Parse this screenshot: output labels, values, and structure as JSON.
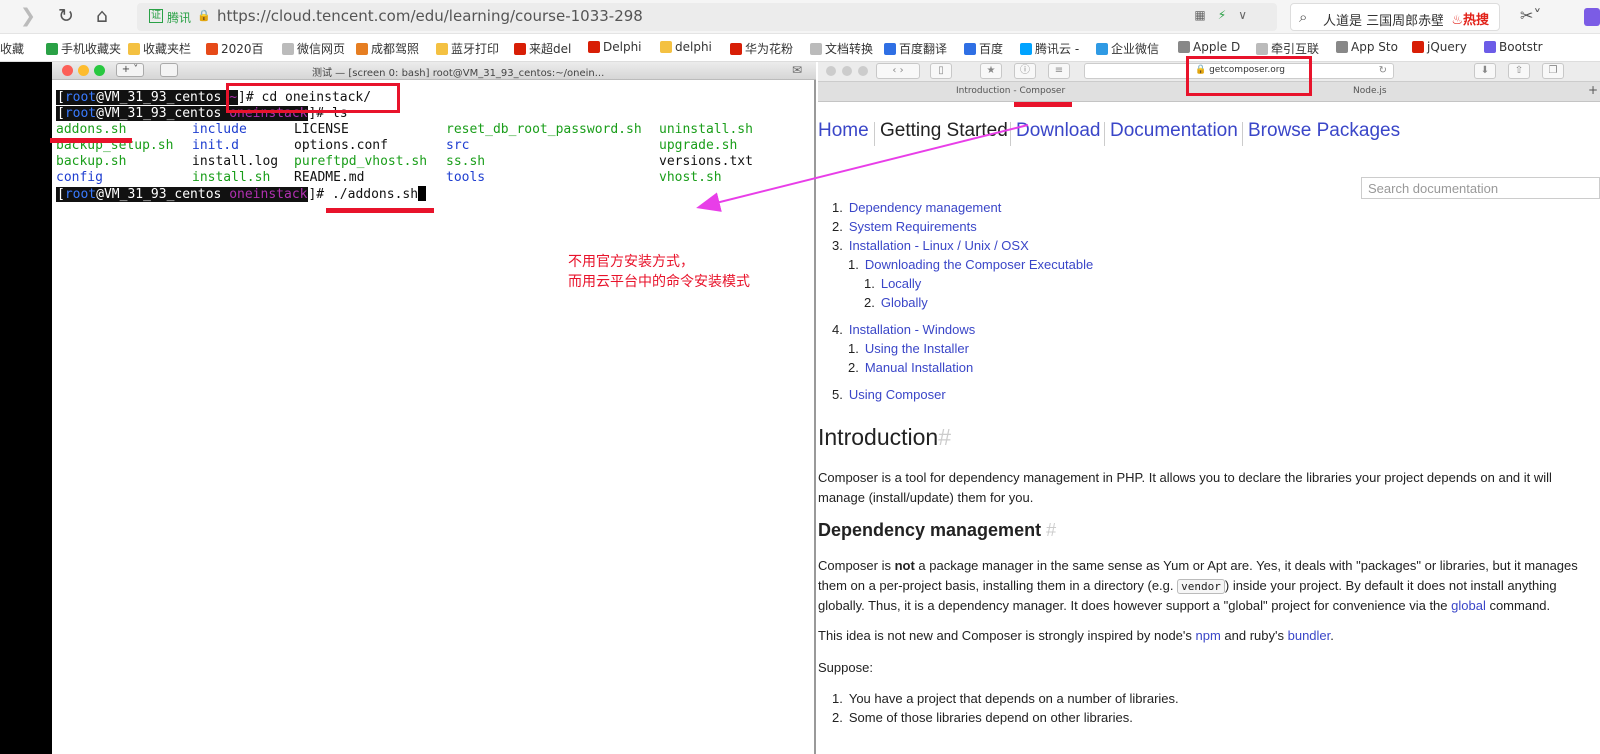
{
  "address_bar": {
    "cert_label": "证",
    "site_name": "腾讯",
    "url": "https://cloud.tencent.com/edu/learning/course-1033-298",
    "search_text": "人道是 三国周郎赤壁",
    "hot_label": "热搜"
  },
  "bookmarks": [
    {
      "label": "收藏",
      "color": "#ffffff"
    },
    {
      "label": "手机收藏夹",
      "color": "#2aa146"
    },
    {
      "label": "收藏夹栏",
      "color": "#f4c142"
    },
    {
      "label": "2020百",
      "color": "#e64a19"
    },
    {
      "label": "微信网页",
      "color": "#bbbbbb"
    },
    {
      "label": "成都驾照",
      "color": "#e67e22"
    },
    {
      "label": "蓝牙打印",
      "color": "#f4c142"
    },
    {
      "label": "来超del",
      "color": "#d81e06"
    },
    {
      "label": "Delphi",
      "color": "#d81e06"
    },
    {
      "label": "delphi",
      "color": "#f4c142"
    },
    {
      "label": "华为花粉",
      "color": "#d81e06"
    },
    {
      "label": "文档转换",
      "color": "#bbbbbb"
    },
    {
      "label": "百度翻译",
      "color": "#2f6fe4"
    },
    {
      "label": "百度",
      "color": "#2f6fe4"
    },
    {
      "label": "腾讯云 -",
      "color": "#00a3ff"
    },
    {
      "label": "企业微信",
      "color": "#2f9ae4"
    },
    {
      "label": "Apple D",
      "color": "#888888"
    },
    {
      "label": "牵引互联",
      "color": "#bbbbbb"
    },
    {
      "label": "App Sto",
      "color": "#888888"
    },
    {
      "label": "jQuery",
      "color": "#d81e06"
    },
    {
      "label": "Bootstr",
      "color": "#6c5ce7"
    }
  ],
  "terminal": {
    "title": "测试 — [screen 0: bash] root@VM_31_93_centos:~/onein...",
    "line1_user": "root",
    "line1_host": "@VM_31_93_centos ",
    "line1_dir": "~",
    "line1_cmd": "]# cd oneinstack/",
    "line2_user": "root",
    "line2_host": "@VM_31_93_centos ",
    "line2_dir": "oneinstack",
    "line2_cmd": "]# ls",
    "files": [
      {
        "name": "addons.sh",
        "color": "green",
        "col": 0,
        "row": 0
      },
      {
        "name": "include",
        "color": "blue",
        "col": 1,
        "row": 0
      },
      {
        "name": "LICENSE",
        "color": "black",
        "col": 2,
        "row": 0
      },
      {
        "name": "reset_db_root_password.sh",
        "color": "green",
        "col": 3,
        "row": 0
      },
      {
        "name": "uninstall.sh",
        "color": "green",
        "col": 4,
        "row": 0
      },
      {
        "name": "backup_setup.sh",
        "color": "green",
        "col": 0,
        "row": 1
      },
      {
        "name": "init.d",
        "color": "blue",
        "col": 1,
        "row": 1
      },
      {
        "name": "options.conf",
        "color": "black",
        "col": 2,
        "row": 1
      },
      {
        "name": "src",
        "color": "blue",
        "col": 3,
        "row": 1
      },
      {
        "name": "upgrade.sh",
        "color": "green",
        "col": 4,
        "row": 1
      },
      {
        "name": "backup.sh",
        "color": "green",
        "col": 0,
        "row": 2
      },
      {
        "name": "install.log",
        "color": "black",
        "col": 1,
        "row": 2
      },
      {
        "name": "pureftpd_vhost.sh",
        "color": "green",
        "col": 2,
        "row": 2
      },
      {
        "name": "ss.sh",
        "color": "green",
        "col": 3,
        "row": 2
      },
      {
        "name": "versions.txt",
        "color": "black",
        "col": 4,
        "row": 2
      },
      {
        "name": "config",
        "color": "blue",
        "col": 0,
        "row": 3
      },
      {
        "name": "install.sh",
        "color": "green",
        "col": 1,
        "row": 3
      },
      {
        "name": "README.md",
        "color": "black",
        "col": 2,
        "row": 3
      },
      {
        "name": "tools",
        "color": "blue",
        "col": 3,
        "row": 3
      },
      {
        "name": "vhost.sh",
        "color": "green",
        "col": 4,
        "row": 3
      }
    ],
    "line3_user": "root",
    "line3_host": "@VM_31_93_centos ",
    "line3_dir": "oneinstack",
    "line3_cmd": "]# ./addons.sh",
    "note_line1": "不用官方安装方式，",
    "note_line2": "而用云平台中的命令安装模式"
  },
  "browser": {
    "address": "getcomposer.org",
    "tab_active": "Introduction - Composer",
    "tab_other": "Node.js",
    "nav": [
      "Home",
      "Getting Started",
      "Download",
      "Documentation",
      "Browse Packages"
    ],
    "search_placeholder": "Search documentation",
    "toc": [
      {
        "num": "1.",
        "label": "Dependency management"
      },
      {
        "num": "2.",
        "label": "System Requirements"
      },
      {
        "num": "3.",
        "label": "Installation - Linux / Unix / OSX"
      },
      {
        "num": "1.",
        "label": "Downloading the Composer Executable"
      },
      {
        "num": "1.",
        "label": "Locally"
      },
      {
        "num": "2.",
        "label": "Globally"
      },
      {
        "num": "4.",
        "label": "Installation - Windows"
      },
      {
        "num": "1.",
        "label": "Using the Installer"
      },
      {
        "num": "2.",
        "label": "Manual Installation"
      },
      {
        "num": "5.",
        "label": "Using Composer"
      }
    ],
    "intro_heading": "Introduction",
    "intro_text": "Composer is a tool for dependency management in PHP. It allows you to declare the libraries your project depends on and it will manage (install/update) them for you.",
    "dep_heading": "Dependency management",
    "dep_p1_a": "Composer is ",
    "dep_p1_bold": "not",
    "dep_p1_b": " a package manager in the same sense as Yum or Apt are. Yes, it deals with \"packages\" or libraries, but it manages them on a per-project basis, installing them in a directory (e.g. ",
    "dep_p1_code": "vendor",
    "dep_p1_c": ") inside your project. By default it does not install anything globally. Thus, it is a dependency manager. It does however support a \"global\" project for convenience via the ",
    "dep_p1_link": "global",
    "dep_p1_d": " command.",
    "dep_p2_a": "This idea is not new and Composer is strongly inspired by node's ",
    "dep_p2_link1": "npm",
    "dep_p2_b": " and ruby's ",
    "dep_p2_link2": "bundler",
    "dep_p2_c": ".",
    "suppose": "Suppose:",
    "list": [
      {
        "num": "1.",
        "label": "You have a project that depends on a number of libraries."
      },
      {
        "num": "2.",
        "label": "Some of those libraries depend on other libraries."
      }
    ]
  },
  "colors": {
    "annotation_red": "#e8132b",
    "arrow_magenta": "#e83ee8",
    "link_blue": "#3a46c8"
  }
}
